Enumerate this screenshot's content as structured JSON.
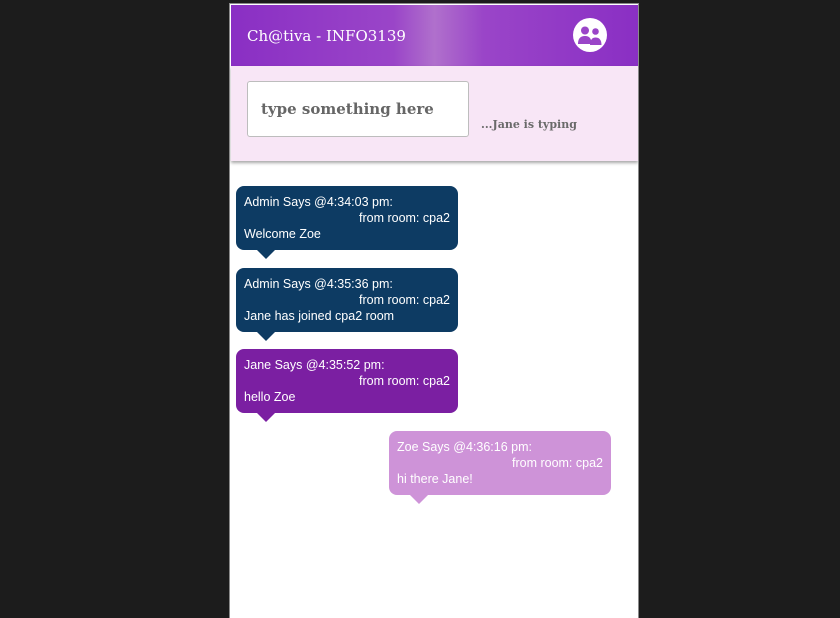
{
  "header": {
    "title": "Ch@tiva - INFO3139",
    "icon": "users-icon"
  },
  "composer": {
    "placeholder": "type something here",
    "value": "",
    "typing_status": "...Jane is typing"
  },
  "messages": [
    {
      "sender_line": "Admin Says @4:34:03 pm:",
      "room_line": "from room: cpa2",
      "text": "Welcome Zoe",
      "color": "#0d3b63",
      "side": "left"
    },
    {
      "sender_line": "Admin Says @4:35:36 pm:",
      "room_line": "from room: cpa2",
      "text": "Jane has joined cpa2 room",
      "color": "#0d3b63",
      "side": "left"
    },
    {
      "sender_line": "Jane Says @4:35:52 pm:",
      "room_line": "from room: cpa2",
      "text": "hello Zoe",
      "color": "#7b1fa2",
      "side": "left"
    },
    {
      "sender_line": "Zoe Says @4:36:16 pm:",
      "room_line": "from room: cpa2",
      "text": "hi there Jane!",
      "color": "#ce93d8",
      "side": "right"
    }
  ]
}
